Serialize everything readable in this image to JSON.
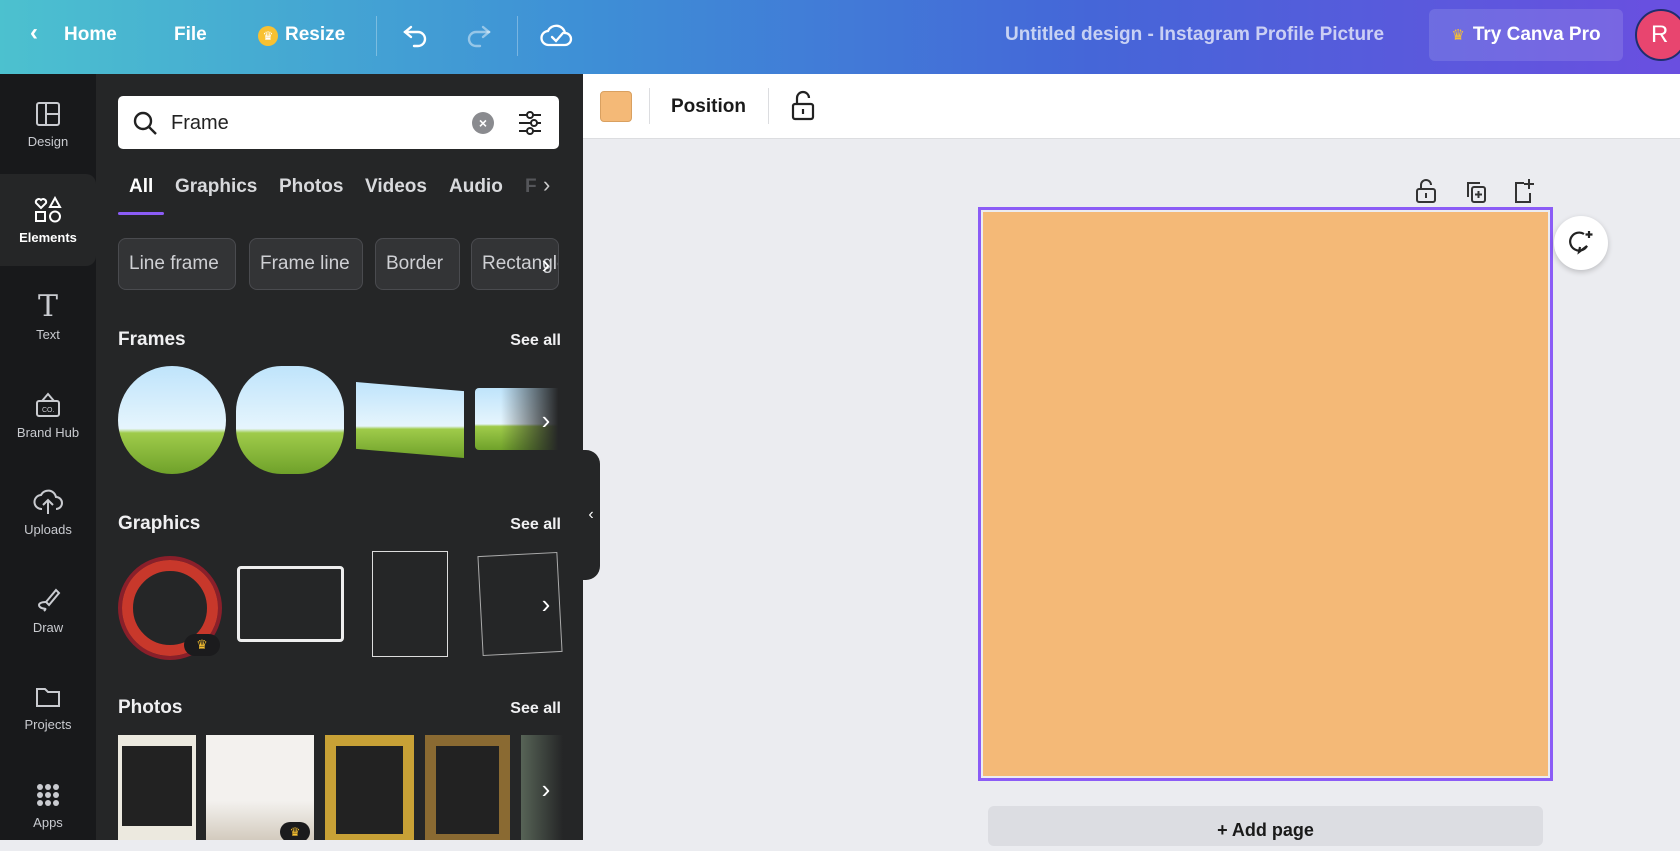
{
  "header": {
    "home": "Home",
    "file": "File",
    "resize": "Resize",
    "title": "Untitled design - Instagram Profile Picture",
    "try_pro": "Try Canva Pro",
    "avatar_initial": "R"
  },
  "rail": [
    {
      "label": "Design",
      "icon": "layout-icon"
    },
    {
      "label": "Elements",
      "icon": "shapes-icon"
    },
    {
      "label": "Text",
      "icon": "text-icon"
    },
    {
      "label": "Brand Hub",
      "icon": "brand-icon"
    },
    {
      "label": "Uploads",
      "icon": "upload-icon"
    },
    {
      "label": "Draw",
      "icon": "draw-icon"
    },
    {
      "label": "Projects",
      "icon": "folder-icon"
    },
    {
      "label": "Apps",
      "icon": "apps-icon"
    }
  ],
  "search": {
    "value": "Frame"
  },
  "tabs": [
    "All",
    "Graphics",
    "Photos",
    "Videos",
    "Audio",
    "F"
  ],
  "chips": [
    "Line frame",
    "Frame line",
    "Border",
    "Rectangle"
  ],
  "sections": {
    "frames": "Frames",
    "graphics": "Graphics",
    "photos": "Photos",
    "see_all": "See all"
  },
  "toolbar": {
    "position": "Position",
    "fill_color": "#f4b977"
  },
  "canvas": {
    "add_page": "+ Add page",
    "selection_color": "#8b5cf6"
  }
}
